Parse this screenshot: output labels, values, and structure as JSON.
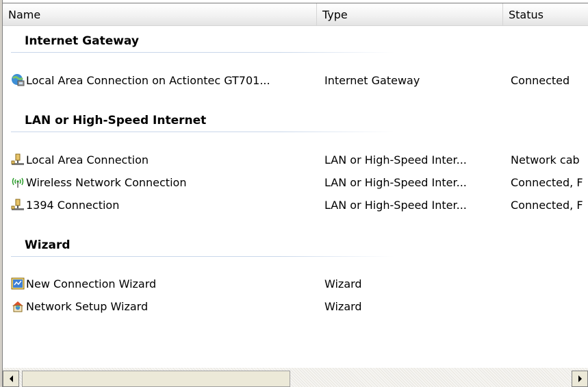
{
  "columns": {
    "name": "Name",
    "type": "Type",
    "status": "Status"
  },
  "groups": [
    {
      "title": "Internet Gateway",
      "items": [
        {
          "name": "Local Area Connection on Actiontec GT701...",
          "type": "Internet Gateway",
          "status": "Connected",
          "icon": "internet-gateway-icon"
        }
      ]
    },
    {
      "title": "LAN or High-Speed Internet",
      "items": [
        {
          "name": "Local Area Connection",
          "type": "LAN or High-Speed Inter...",
          "status": "Network cab",
          "icon": "lan-connection-icon"
        },
        {
          "name": "Wireless Network Connection",
          "type": "LAN or High-Speed Inter...",
          "status": "Connected, F",
          "icon": "wireless-connection-icon"
        },
        {
          "name": "1394 Connection",
          "type": "LAN or High-Speed Inter...",
          "status": "Connected, F",
          "icon": "lan-connection-icon"
        }
      ]
    },
    {
      "title": "Wizard",
      "items": [
        {
          "name": "New Connection Wizard",
          "type": "Wizard",
          "status": "",
          "icon": "new-connection-wizard-icon"
        },
        {
          "name": "Network Setup Wizard",
          "type": "Wizard",
          "status": "",
          "icon": "network-setup-wizard-icon"
        }
      ]
    }
  ],
  "colors": {
    "group_divider": "#c9d7ea",
    "header_background": "#f1f1f1",
    "window_background": "#ffffff"
  }
}
